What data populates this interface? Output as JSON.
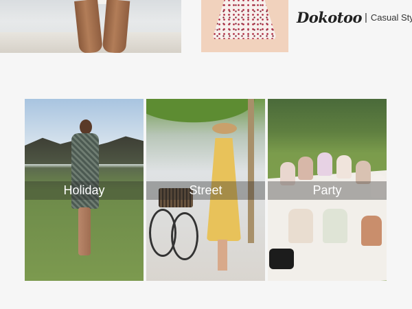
{
  "brand": {
    "logo": "Dokotoo",
    "separator": "|",
    "tagline": "Casual Style"
  },
  "cards": [
    {
      "label": "Holiday"
    },
    {
      "label": "Street"
    },
    {
      "label": "Party"
    }
  ]
}
